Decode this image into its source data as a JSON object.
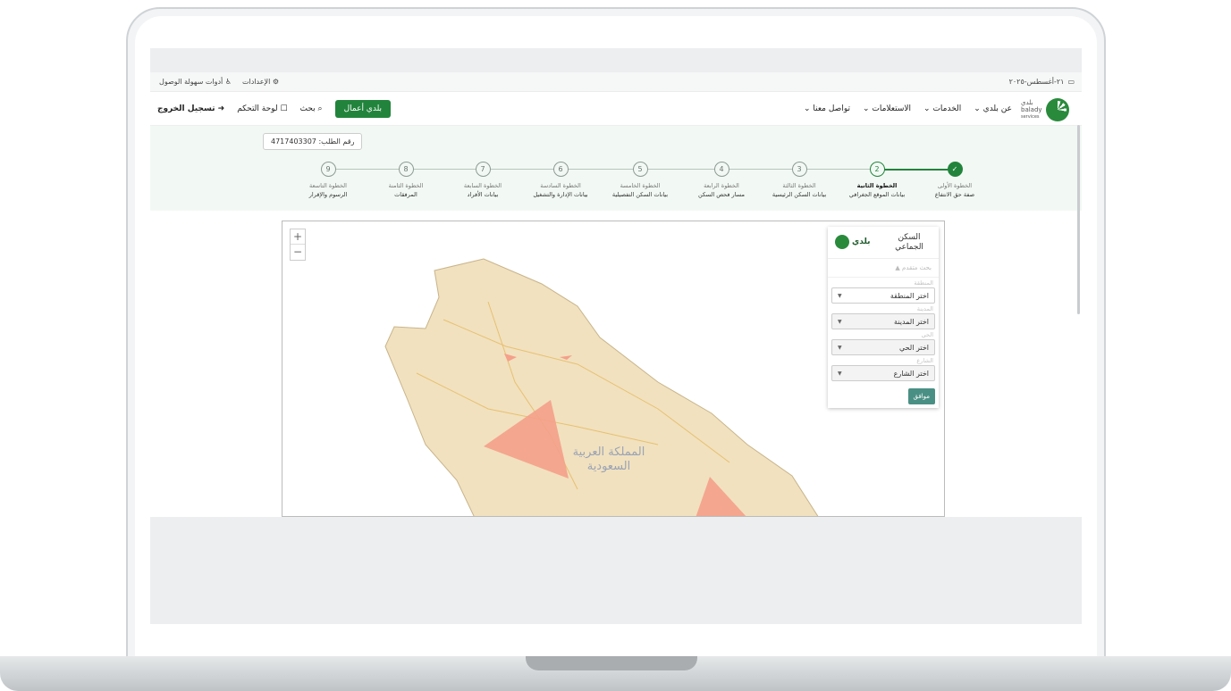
{
  "topbar": {
    "date": "٢١-أغسطس-٢٠٢٥",
    "settings": "الإعدادات",
    "accessibility": "أدوات سهولة الوصول"
  },
  "brand": {
    "name_ar": "بلدي",
    "name_en": "balady",
    "sub": "services"
  },
  "menu": [
    {
      "label": "عن بلدي"
    },
    {
      "label": "الخدمات"
    },
    {
      "label": "الاستعلامات"
    },
    {
      "label": "تواصل معنا"
    }
  ],
  "nav_actions": {
    "business": "بلدي أعمال",
    "search": "بحث",
    "dashboard": "لوحة التحكم",
    "logout": "تسجيل الخروج"
  },
  "order": {
    "label": "رقم الطلب:",
    "number": "4717403307"
  },
  "steps": [
    {
      "num": "✓",
      "title": "الخطوة الأولى",
      "subtitle": "صفة حق الانتفاع",
      "state": "done"
    },
    {
      "num": "2",
      "title": "الخطوة الثانية",
      "subtitle": "بيانات الموقع الجغرافي",
      "state": "current"
    },
    {
      "num": "3",
      "title": "الخطوة الثالثة",
      "subtitle": "بيانات السكن الرئيسية",
      "state": "todo"
    },
    {
      "num": "4",
      "title": "الخطوة الرابعة",
      "subtitle": "مسار فحص السكن",
      "state": "todo"
    },
    {
      "num": "5",
      "title": "الخطوة الخامسة",
      "subtitle": "بيانات السكن التفصيلية",
      "state": "todo"
    },
    {
      "num": "6",
      "title": "الخطوة السادسة",
      "subtitle": "بيانات الإدارة والتشغيل",
      "state": "todo"
    },
    {
      "num": "7",
      "title": "الخطوة السابعة",
      "subtitle": "بيانات الأفراد",
      "state": "todo"
    },
    {
      "num": "8",
      "title": "الخطوة الثامنة",
      "subtitle": "المرفقات",
      "state": "todo"
    },
    {
      "num": "9",
      "title": "الخطوة التاسعة",
      "subtitle": "الرسوم والإقرار",
      "state": "todo"
    }
  ],
  "map": {
    "zoom_in": "+",
    "zoom_out": "−",
    "country_label": "المملكة العربية السعودية",
    "land_color": "#f1e1bf",
    "polygon_color": "#f4a08a"
  },
  "panel": {
    "title": "السكن الجماعي",
    "advanced_search": "بحث متقدم",
    "region_label": "المنطقة",
    "region_value": "اختر المنطقة",
    "city_label": "المدينة",
    "city_value": "اختر المدينة",
    "district_label": "الحي",
    "district_value": "اختر الحي",
    "street_label": "الشارع",
    "street_value": "اختر الشارع",
    "ok": "موافق"
  },
  "colors": {
    "accent": "#22843c",
    "band": "#f2f9f4"
  }
}
